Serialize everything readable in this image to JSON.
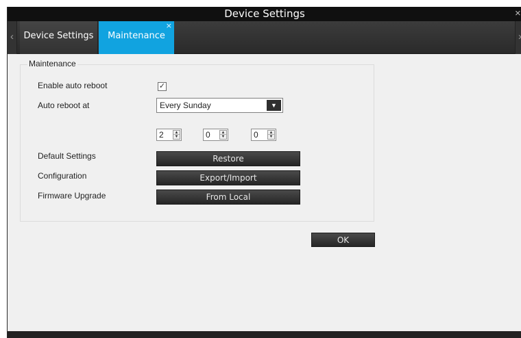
{
  "window": {
    "title": "Device Settings",
    "close_glyph": "×"
  },
  "tabs": {
    "prev_glyph": "‹",
    "next_glyph": "›",
    "items": [
      {
        "label": "Device Settings",
        "active": false
      },
      {
        "label": "Maintenance",
        "active": true,
        "close_glyph": "×"
      }
    ]
  },
  "maintenance": {
    "group_title": "Maintenance",
    "auto_reboot_label": "Enable auto reboot",
    "auto_reboot_checked": true,
    "check_glyph": "✓",
    "reboot_at_label": "Auto reboot at",
    "reboot_day": "Every Sunday",
    "dropdown_glyph": "▼",
    "spin_up_glyph": "▲",
    "spin_down_glyph": "▼",
    "reboot_time": {
      "hour": "2",
      "minute": "0",
      "second": "0"
    },
    "default_settings_label": "Default Settings",
    "restore_button": "Restore",
    "configuration_label": "Configuration",
    "export_import_button": "Export/Import",
    "firmware_label": "Firmware Upgrade",
    "from_local_button": "From Local"
  },
  "footer": {
    "ok_button": "OK"
  },
  "colors": {
    "active_tab": "#11a3e0",
    "titlebar": "#101010",
    "button_dark": "#2f2f2f"
  }
}
